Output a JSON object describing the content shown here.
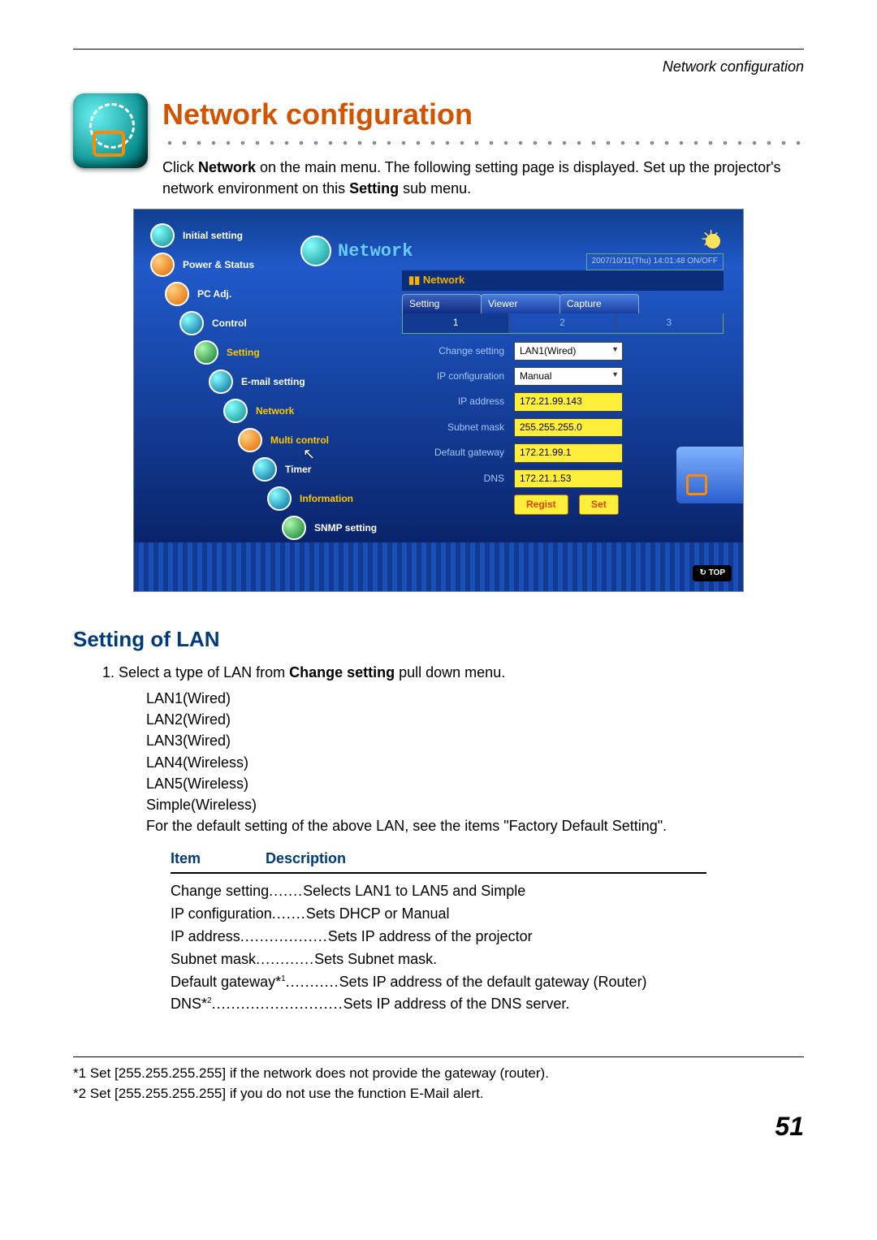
{
  "header": {
    "section": "Network configuration"
  },
  "title": "Network configuration",
  "intro": {
    "pre": "Click ",
    "bold1": "Network",
    "mid": " on the main menu. The following setting page is displayed. Set up the projector's network environment on this ",
    "bold2": "Setting",
    "post": " sub menu."
  },
  "ui": {
    "sidebar": {
      "items": [
        {
          "label": "Initial setting"
        },
        {
          "label": "Power & Status"
        },
        {
          "label": "PC Adj."
        },
        {
          "label": "Control"
        },
        {
          "label": "Setting"
        },
        {
          "label": "E-mail setting"
        },
        {
          "label": "Network"
        },
        {
          "label": "Multi control"
        },
        {
          "label": "Timer"
        },
        {
          "label": "Information"
        },
        {
          "label": "SNMP setting"
        }
      ]
    },
    "badge": "Network",
    "datetime": "2007/10/11(Thu) 14:01:48  ON/OFF",
    "panel_title": "Network",
    "tabs": [
      "Setting",
      "Viewer",
      "Capture"
    ],
    "subtabs": [
      "1",
      "2",
      "3"
    ],
    "form": {
      "change_setting": {
        "label": "Change setting",
        "value": "LAN1(Wired)"
      },
      "ip_config": {
        "label": "IP configuration",
        "value": "Manual"
      },
      "ip_addr": {
        "label": "IP address",
        "value": "172.21.99.143"
      },
      "subnet": {
        "label": "Subnet mask",
        "value": "255.255.255.0"
      },
      "gateway": {
        "label": "Default gateway",
        "value": "172.21.99.1"
      },
      "dns": {
        "label": "DNS",
        "value": "172.21.1.53"
      }
    },
    "buttons": {
      "regist": "Regist",
      "set": "Set"
    },
    "top_btn": "TOP"
  },
  "section_heading": "Setting of LAN",
  "step1": {
    "num": "1. ",
    "pre": "Select a type of LAN from ",
    "bold": "Change setting",
    "post": " pull down menu."
  },
  "lan_options": [
    "LAN1(Wired)",
    "LAN2(Wired)",
    "LAN3(Wired)",
    "LAN4(Wireless)",
    "LAN5(Wireless)",
    "Simple(Wireless)"
  ],
  "default_note": "For the default setting of the above LAN, see the items \"Factory Default Setting\".",
  "table": {
    "head_item": "Item",
    "head_desc": "Description",
    "rows": [
      {
        "item": "Change setting",
        "dots": ".......",
        "desc": "Selects LAN1 to LAN5 and Simple"
      },
      {
        "item": "IP configuration",
        "dots": ".......",
        "desc": "Sets DHCP or Manual"
      },
      {
        "item": "IP address",
        "dots": "..................",
        "desc": "Sets IP address of the projector"
      },
      {
        "item": "Subnet mask",
        "dots": "............",
        "desc": "Sets Subnet mask."
      },
      {
        "item": "Default gateway*",
        "sup": "1",
        "dots": "...........",
        "desc": "Sets IP address of the default gateway (Router)"
      },
      {
        "item": "DNS*",
        "sup": "2",
        "dots": "...........................",
        "desc": "Sets IP address of the DNS server."
      }
    ]
  },
  "footnotes": [
    "*1 Set [255.255.255.255] if the network does not provide the gateway (router).",
    "*2 Set [255.255.255.255] if you do not use the function E-Mail alert."
  ],
  "page_number": "51"
}
